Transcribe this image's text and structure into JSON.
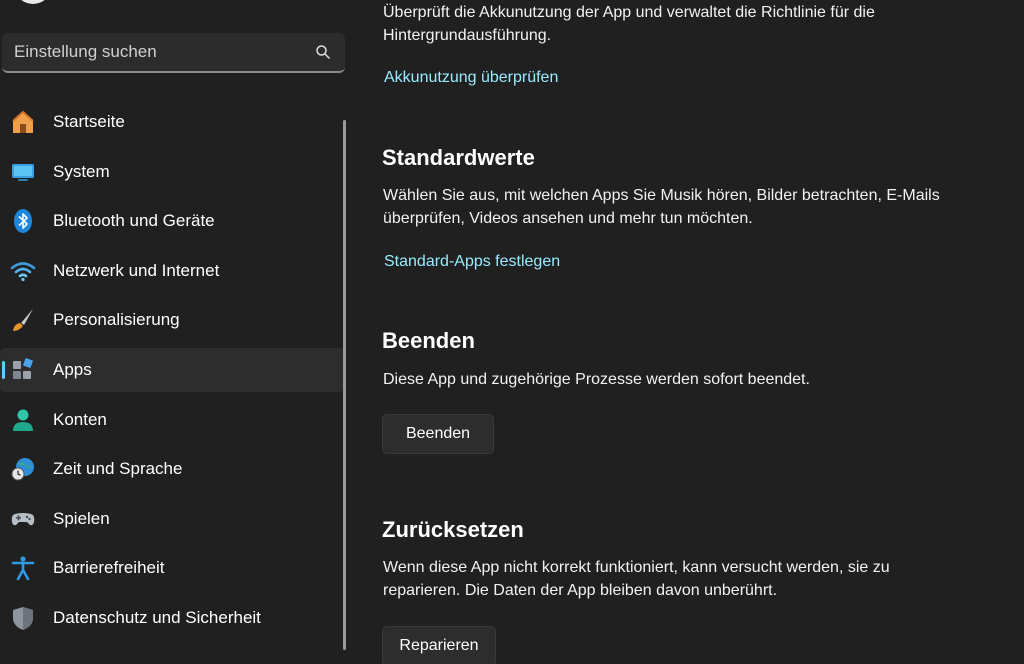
{
  "search": {
    "placeholder": "Einstellung suchen",
    "icon": "search-icon"
  },
  "sidebar": {
    "items": [
      {
        "label": "Startseite",
        "icon": "home-icon"
      },
      {
        "label": "System",
        "icon": "monitor-icon"
      },
      {
        "label": "Bluetooth und Geräte",
        "icon": "bluetooth-icon"
      },
      {
        "label": "Netzwerk und Internet",
        "icon": "wifi-icon"
      },
      {
        "label": "Personalisierung",
        "icon": "paintbrush-icon"
      },
      {
        "label": "Apps",
        "icon": "apps-icon",
        "selected": true
      },
      {
        "label": "Konten",
        "icon": "person-icon"
      },
      {
        "label": "Zeit und Sprache",
        "icon": "globe-clock-icon"
      },
      {
        "label": "Spielen",
        "icon": "gamepad-icon"
      },
      {
        "label": "Barrierefreiheit",
        "icon": "accessibility-icon"
      },
      {
        "label": "Datenschutz und Sicherheit",
        "icon": "shield-icon"
      }
    ]
  },
  "battery": {
    "description": "Überprüft die Akkunutzung der App und verwaltet die Richtlinie für die Hintergrundausführung.",
    "link": "Akkunutzung überprüfen"
  },
  "defaults": {
    "title": "Standardwerte",
    "description": "Wählen Sie aus, mit welchen Apps Sie Musik hören, Bilder betrachten, E-Mails überprüfen, Videos ansehen und mehr tun möchten.",
    "link": "Standard-Apps festlegen"
  },
  "terminate": {
    "title": "Beenden",
    "description": "Diese App und zugehörige Prozesse werden sofort beendet.",
    "button": "Beenden"
  },
  "reset": {
    "title": "Zurücksetzen",
    "description": "Wenn diese App nicht korrekt funktioniert, kann versucht werden, sie zu reparieren. Die Daten der App bleiben davon unberührt.",
    "button": "Reparieren"
  },
  "colors": {
    "accent": "#60cdff",
    "link": "#99ebff",
    "background": "#202020"
  }
}
